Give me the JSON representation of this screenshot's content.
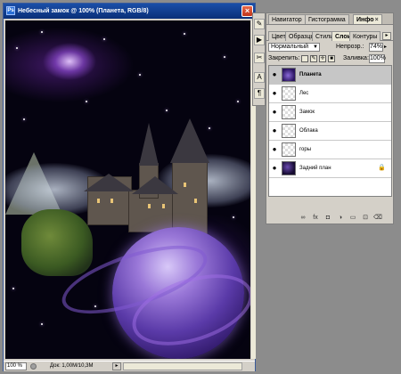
{
  "document": {
    "title": "Небесный замок @ 100% (Планета, RGB/8)",
    "app_icon": "Ps",
    "close_label": "×",
    "status": {
      "zoom": "100 %",
      "info": "Док: 1,00M/10,3M",
      "menu_arrow": "▸"
    }
  },
  "toolstrip": {
    "icons": [
      "history-brush-icon",
      "play-icon",
      "tools-icon",
      "text-icon",
      "paragraph-icon"
    ],
    "glyphs": [
      "✎",
      "▶",
      "✂",
      "A",
      "¶"
    ]
  },
  "palette": {
    "top_tabs": [
      "Навигатор",
      "Гистограмма",
      "Инфо"
    ],
    "top_tab_close": "×",
    "tabs": [
      "Цвет",
      "Образцы",
      "Стили",
      "Слои",
      "Контуры"
    ],
    "active_tab": "Слои",
    "menu_glyph": "▸",
    "blend_mode": "Нормальный",
    "opacity_label": "Непрозр.:",
    "opacity_value": "74%",
    "lock_label": "Закрепить:",
    "fill_label": "Заливка:",
    "fill_value": "100%",
    "layers": [
      {
        "name": "Планета",
        "selected": true
      },
      {
        "name": "Лес",
        "selected": false
      },
      {
        "name": "Замок",
        "selected": false
      },
      {
        "name": "Облака",
        "selected": false
      },
      {
        "name": "горы",
        "selected": false
      },
      {
        "name": "Задний план",
        "selected": false,
        "locked": true
      }
    ],
    "eye_glyph": "●",
    "bottom_icons": [
      "link-icon",
      "fx-icon",
      "mask-icon",
      "adjustment-icon",
      "folder-icon",
      "new-layer-icon",
      "trash-icon"
    ],
    "bottom_glyphs": [
      "∞",
      "fx",
      "◘",
      "◑",
      "▭",
      "⊡",
      "⌫"
    ]
  },
  "colors": {
    "titlebar": "#0a2f78",
    "panel": "#d4d0c8",
    "selected_layer": "#c6c6c6"
  }
}
